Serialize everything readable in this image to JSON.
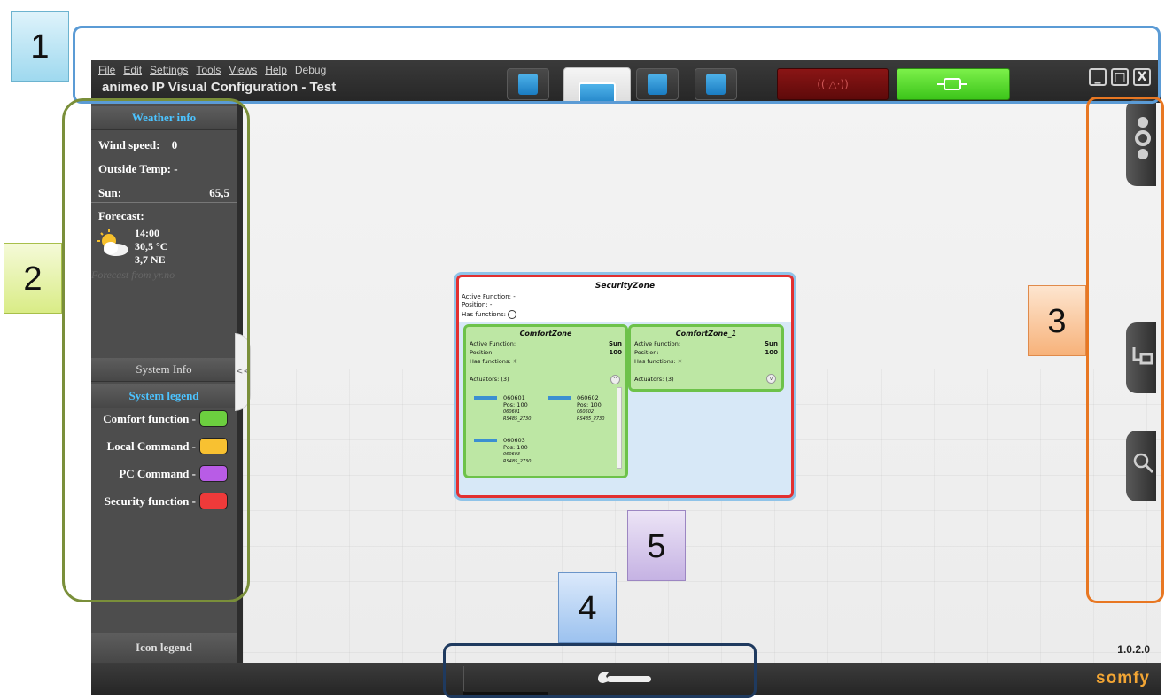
{
  "window": {
    "title": "animeo IP Visual Configuration - Test",
    "menu": [
      "File",
      "Edit",
      "Settings",
      "Tools",
      "Views",
      "Help",
      "Debug"
    ]
  },
  "weather": {
    "header": "Weather info",
    "wind_label": "Wind speed:",
    "wind_value": "0",
    "temp_label": "Outside Temp:",
    "temp_value": "-",
    "sun_label": "Sun:",
    "sun_value": "65,5",
    "forecast_label": "Forecast:",
    "forecast_time": "14:00",
    "forecast_temp": "30,5 °C",
    "forecast_wind": "3,7 NE",
    "forecast_source": "Forecast from yr.no"
  },
  "system_info": "System Info",
  "legend": {
    "header": "System legend",
    "items": [
      {
        "label": "Comfort function -",
        "color": "#6ccf3f"
      },
      {
        "label": "Local Command -",
        "color": "#f8c131"
      },
      {
        "label": "PC Command -",
        "color": "#b85ce6"
      },
      {
        "label": "Security function -",
        "color": "#ef3a3a"
      }
    ]
  },
  "icon_legend": "Icon legend",
  "version": "1.0.2.0",
  "brand": "somfy",
  "zone": {
    "title": "SecurityZone",
    "active_function": "Active Function: -",
    "position": "Position: -",
    "has_functions": "Has functions:",
    "subzones": [
      {
        "title": "ComfortZone",
        "active_function_label": "Active Function:",
        "active_function_value": "Sun",
        "position_label": "Position:",
        "position_value": "100",
        "has_functions": "Has functions:",
        "actuators": "Actuators: (3)",
        "items": [
          {
            "id": "060601",
            "pos": "Pos: 100",
            "code": "060601",
            "bus": "RS485_2730"
          },
          {
            "id": "060602",
            "pos": "Pos: 100",
            "code": "060602",
            "bus": "RS485_2730"
          },
          {
            "id": "060603",
            "pos": "Pos: 100",
            "code": "060603",
            "bus": "RS485_2730"
          }
        ]
      },
      {
        "title": "ComfortZone_1",
        "active_function_label": "Active Function:",
        "active_function_value": "Sun",
        "position_label": "Position:",
        "position_value": "100",
        "has_functions": "Has functions:",
        "actuators": "Actuators: (3)"
      }
    ]
  },
  "annotations": [
    "1",
    "2",
    "3",
    "4",
    "5"
  ],
  "annotation_colors": {
    "1": "#5b9bd5",
    "2": "#7a8f3a",
    "3": "#e87722",
    "4": "#1f3a5f"
  }
}
